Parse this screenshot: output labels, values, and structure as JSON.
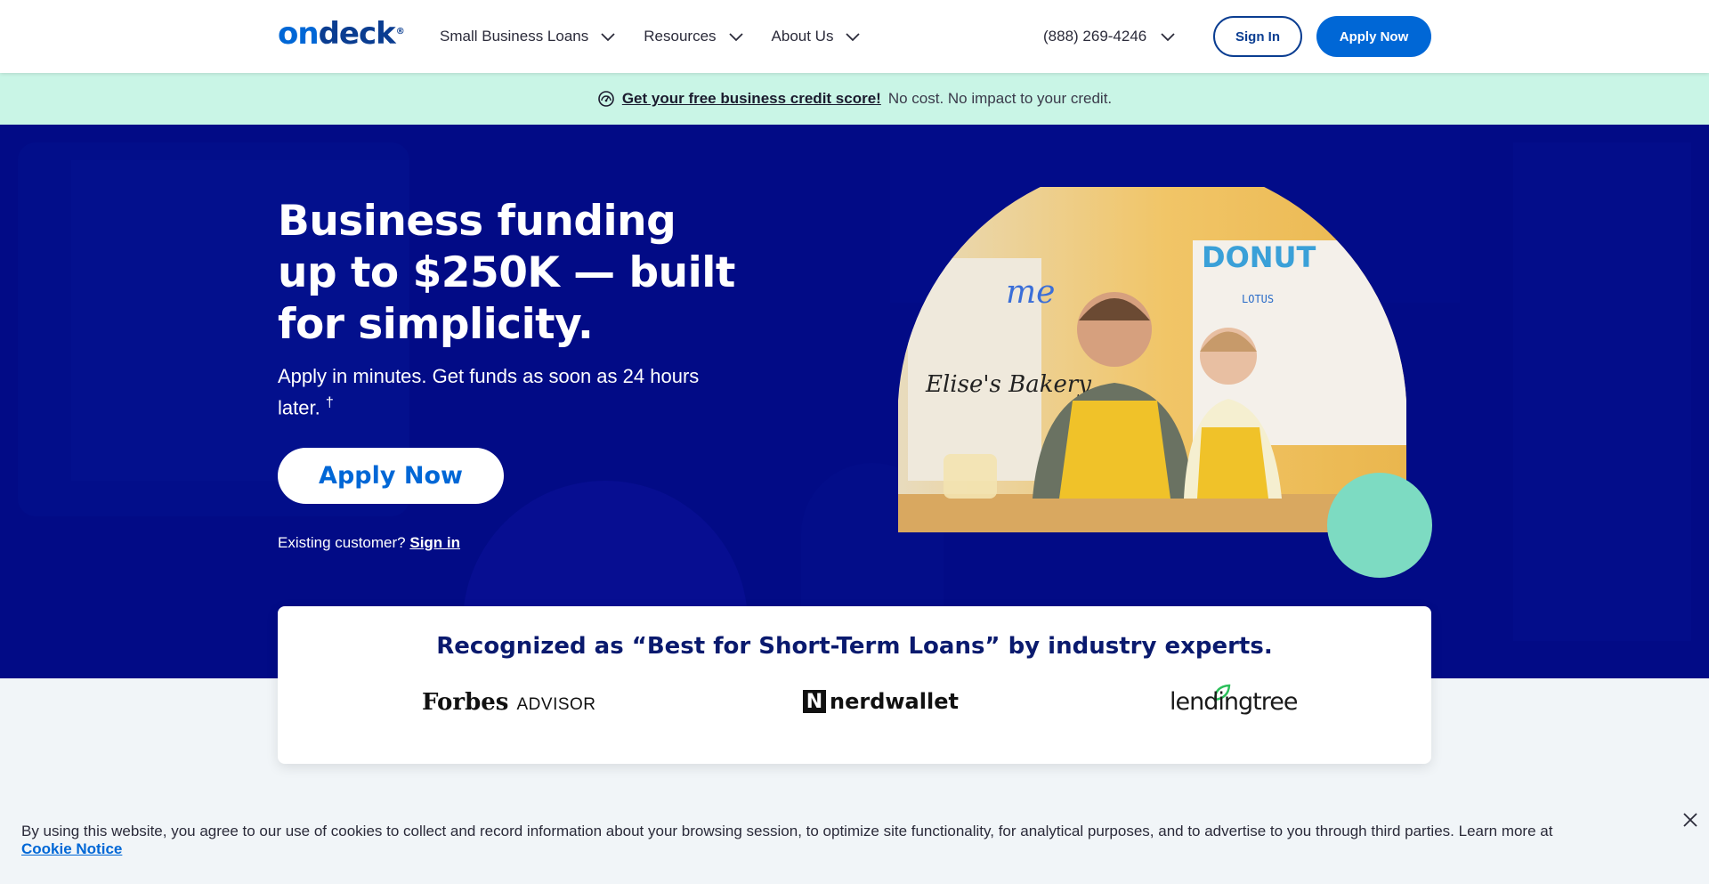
{
  "header": {
    "logo": {
      "on": "on",
      "deck": "deck",
      "reg": "®"
    },
    "nav": [
      {
        "label": "Small Business Loans"
      },
      {
        "label": "Resources"
      },
      {
        "label": "About Us"
      }
    ],
    "phone": "(888) 269-4246",
    "sign_in": "Sign In",
    "apply_now": "Apply Now"
  },
  "promo": {
    "link": "Get your free business credit score!",
    "text": "No cost. No impact to your credit."
  },
  "hero": {
    "title": "Business funding up to $250K — built for simplicity.",
    "subtitle": "Apply in minutes. Get funds as soon as 24 hours later.",
    "dagger": "†",
    "apply_button": "Apply Now",
    "existing_prefix": "Existing customer?",
    "existing_link": "Sign in",
    "photo_signs": {
      "donut": "DONUT",
      "me": "me",
      "menu": "LOTUS",
      "shop": "Elise's Bakery"
    }
  },
  "recognition": {
    "title": "Recognized as “Best for Short-Term Loans” by industry experts.",
    "logos": {
      "forbes": "Forbes",
      "forbes_sub": "ADVISOR",
      "nerdwallet": "nerdwallet",
      "nerdwallet_n": "N",
      "lendingtree": "lendingtree"
    }
  },
  "cookie": {
    "text": "By using this website, you agree to our use of cookies to collect and record information about your browsing session, to optimize site functionality, for analytical purposes, and to advertise to you through third parties. Learn more at",
    "link": "Cookie Notice"
  },
  "colors": {
    "brand_blue": "#0067d6",
    "hero_navy": "#020b86",
    "mint": "#c9f5e6",
    "mint_dark": "#7ddbc2"
  },
  "icons": {
    "promo": "credit-score-icon",
    "close": "close-icon",
    "chevron": "chevron-down-icon"
  }
}
